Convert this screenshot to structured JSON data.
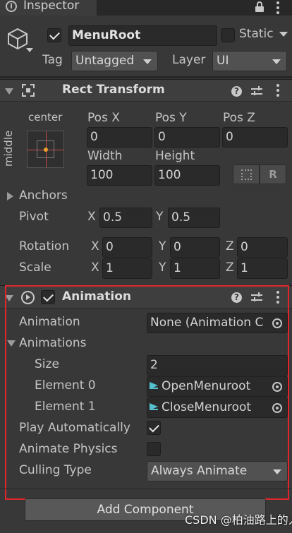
{
  "tab": {
    "title": "Inspector"
  },
  "object": {
    "name": "MenuRoot",
    "active": true,
    "static_label": "Static",
    "tag_label": "Tag",
    "tag_value": "Untagged",
    "layer_label": "Layer",
    "layer_value": "UI"
  },
  "rect_transform": {
    "title": "Rect Transform",
    "anchor_h": "center",
    "anchor_v": "middle",
    "pos_x_label": "Pos X",
    "pos_y_label": "Pos Y",
    "pos_z_label": "Pos Z",
    "pos_x": "0",
    "pos_y": "0",
    "pos_z": "0",
    "width_label": "Width",
    "height_label": "Height",
    "width": "100",
    "height": "100",
    "r_button": "R",
    "anchors_label": "Anchors",
    "pivot_label": "Pivot",
    "pivot_x": "0.5",
    "pivot_y": "0.5",
    "rotation_label": "Rotation",
    "rot_x": "0",
    "rot_y": "0",
    "rot_z": "0",
    "scale_label": "Scale",
    "scale_x": "1",
    "scale_y": "1",
    "scale_z": "1",
    "x": "X",
    "y": "Y",
    "z": "Z"
  },
  "animation": {
    "title": "Animation",
    "enabled": true,
    "animation_label": "Animation",
    "animation_value": "None (Animation C",
    "animations_label": "Animations",
    "size_label": "Size",
    "size_value": "2",
    "element0_label": "Element 0",
    "element0_value": "OpenMenuroot",
    "element1_label": "Element 1",
    "element1_value": "CloseMenuroot",
    "play_auto_label": "Play Automatically",
    "play_auto": true,
    "animate_physics_label": "Animate Physics",
    "animate_physics": false,
    "culling_label": "Culling Type",
    "culling_value": "Always Animate"
  },
  "add_component_label": "Add Component",
  "watermark": "CSDN @柏油路上的人",
  "highlight_color": "#e0262d"
}
